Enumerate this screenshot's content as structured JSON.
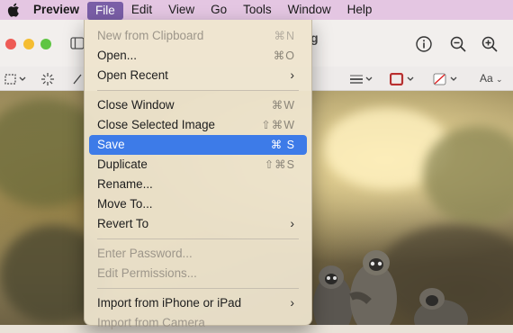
{
  "menubar": {
    "app_name": "Preview",
    "items": [
      "File",
      "Edit",
      "View",
      "Go",
      "Tools",
      "Window",
      "Help"
    ],
    "active_item": "File"
  },
  "window": {
    "title_fragment": "g"
  },
  "format_bar": {
    "font_button": "Aa"
  },
  "file_menu": {
    "items": [
      {
        "label": "New from Clipboard",
        "shortcut": "⌘N",
        "enabled": false
      },
      {
        "label": "Open...",
        "shortcut": "⌘O",
        "enabled": true
      },
      {
        "label": "Open Recent",
        "shortcut": "",
        "submenu": true,
        "enabled": true
      },
      {
        "label": "Close Window",
        "shortcut": "⌘W",
        "enabled": true
      },
      {
        "label": "Close Selected Image",
        "shortcut": "⇧⌘W",
        "enabled": true
      },
      {
        "label": "Save",
        "shortcut": "⌘ S",
        "enabled": true,
        "highlighted": true
      },
      {
        "label": "Duplicate",
        "shortcut": "⇧⌘S",
        "enabled": true
      },
      {
        "label": "Rename...",
        "shortcut": "",
        "enabled": true
      },
      {
        "label": "Move To...",
        "shortcut": "",
        "enabled": true
      },
      {
        "label": "Revert To",
        "shortcut": "",
        "submenu": true,
        "enabled": true
      },
      {
        "label": "Enter Password...",
        "shortcut": "",
        "enabled": false
      },
      {
        "label": "Edit Permissions...",
        "shortcut": "",
        "enabled": false
      },
      {
        "label": "Import from iPhone or iPad",
        "shortcut": "",
        "submenu": true,
        "enabled": true
      },
      {
        "label": "Import from Camera",
        "shortcut": "",
        "enabled": false
      }
    ]
  },
  "colors": {
    "menubar_bg": "#e4c6e2",
    "active_menu_bg": "#7a5ea7",
    "highlight": "#3d7be8",
    "traffic_red": "#ee5b55",
    "traffic_yellow": "#f5bd31",
    "traffic_green": "#5fc543"
  }
}
